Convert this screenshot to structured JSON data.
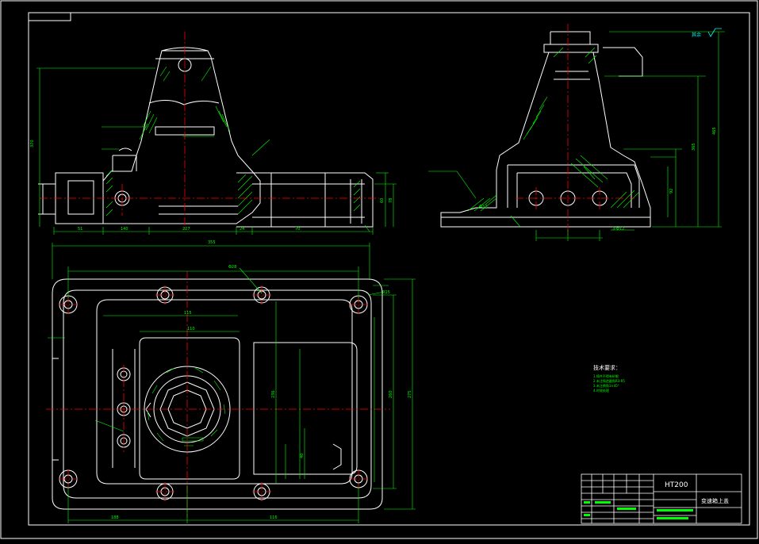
{
  "colors": {
    "background": "#000000",
    "outline": "#ffffff",
    "dimension": "#00ff00",
    "centerline": "#ff0000",
    "hatch": "#00ff00",
    "annotation": "#00ffff"
  },
  "title_block": {
    "material": "HT200",
    "part_name": "变速箱上盖"
  },
  "technical_requirements": {
    "heading": "技术要求：",
    "lines": [
      "1.铸件不得有砂眼",
      "2.未注铸造圆角R3-R5",
      "3.未注倒角1×45°",
      "4.时效处理"
    ]
  },
  "roughness": {
    "label": "其余"
  },
  "dimensions": {
    "top_width": "355",
    "left_height": "370",
    "front_a": "51",
    "front_b": "140",
    "front_c": "227",
    "front_d": "24",
    "front_e": "70",
    "front_h1": "60",
    "front_h2": "78",
    "side_h1": "465",
    "side_h2": "365",
    "side_h3": "92",
    "side_d1": "Φ32",
    "side_d2": "3-Φ12",
    "plan_h1": "236",
    "plan_h2": "260",
    "plan_h3": "275",
    "plan_w1": "115",
    "plan_w2": "110",
    "plan_d1": "Φ28",
    "plan_r": "R15",
    "plan_small": "40",
    "plan_b1": "188",
    "plan_b2": "116"
  }
}
